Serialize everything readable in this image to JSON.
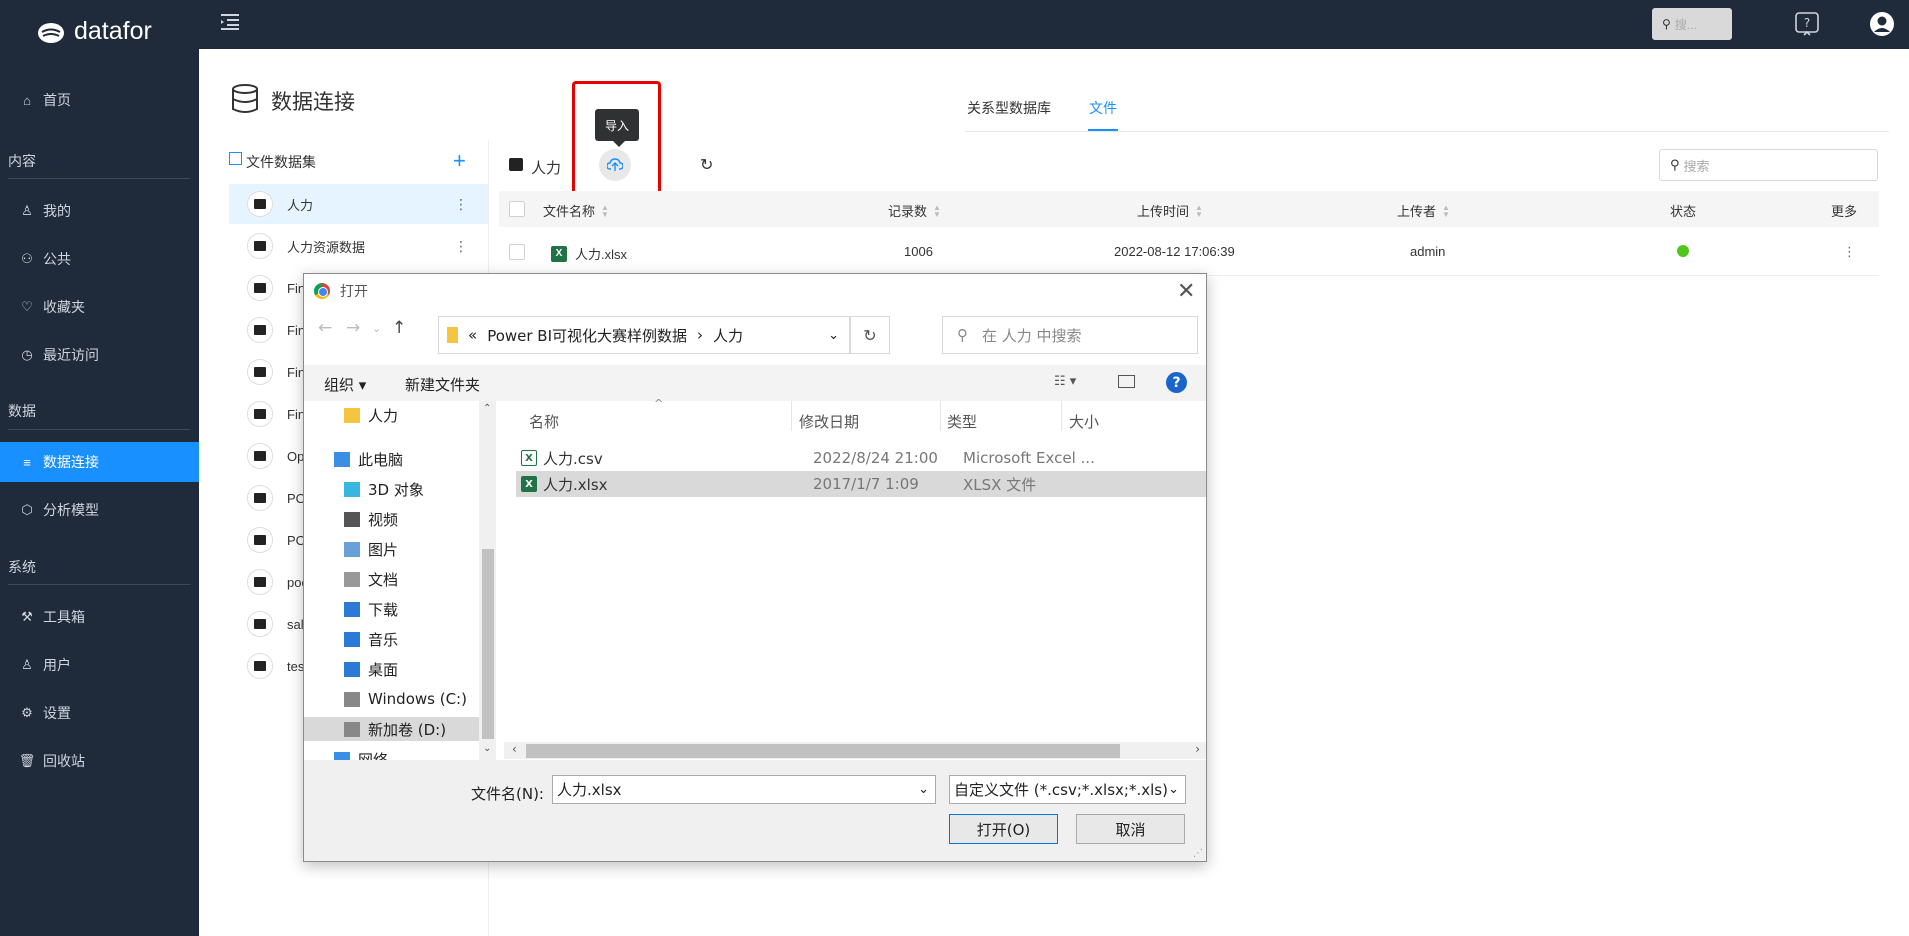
{
  "app": {
    "brand": "datafor"
  },
  "sidebar": {
    "home": "首页",
    "section_content": "内容",
    "mine": "我的",
    "public": "公共",
    "favorites": "收藏夹",
    "recent": "最近访问",
    "section_data": "数据",
    "data_connection": "数据连接",
    "analysis_model": "分析模型",
    "section_system": "系统",
    "toolbox": "工具箱",
    "users": "用户",
    "settings": "设置",
    "recycle": "回收站"
  },
  "topbar": {
    "search_placeholder": "搜..."
  },
  "main": {
    "title": "数据连接",
    "tabs": [
      "关系型数据库",
      "文件"
    ],
    "active_tab": "文件",
    "datasets_title": "文件数据集",
    "datasets": [
      "人力",
      "人力资源数据",
      "Fin",
      "Fin",
      "Fin",
      "Fin",
      "Ope",
      "PO",
      "PO",
      "poo",
      "sale",
      "tes"
    ],
    "folder_name": "人力",
    "upload_tooltip": "导入",
    "list_search_placeholder": "搜索",
    "table_headers": {
      "name": "文件名称",
      "records": "记录数",
      "upload_time": "上传时间",
      "uploader": "上传者",
      "status": "状态",
      "more": "更多"
    },
    "rows": [
      {
        "name": "人力.xlsx",
        "records": "1006",
        "upload_time": "2022-08-12 17:06:39",
        "uploader": "admin",
        "status": "ok"
      }
    ]
  },
  "dialog": {
    "title": "打开",
    "path": [
      "«",
      "Power BI可视化大赛样例数据",
      "›",
      "人力"
    ],
    "search_placeholder": "在 人力 中搜索",
    "organize": "组织 ▾",
    "new_folder": "新建文件夹",
    "tree": [
      "人力",
      "此电脑",
      "3D 对象",
      "视频",
      "图片",
      "文档",
      "下载",
      "音乐",
      "桌面",
      "Windows (C:)",
      "新加卷 (D:)",
      "网络"
    ],
    "columns": [
      "名称",
      "修改日期",
      "类型",
      "大小"
    ],
    "files": [
      {
        "name": "人力.csv",
        "date": "2022/8/24 21:00",
        "type": "Microsoft Excel ..."
      },
      {
        "name": "人力.xlsx",
        "date": "2017/1/7 1:09",
        "type": "XLSX 文件"
      }
    ],
    "filename_label": "文件名(N):",
    "filename_value": "人力.xlsx",
    "filetype_value": "自定义文件 (*.csv;*.xlsx;*.xls)",
    "open_button": "打开(O)",
    "cancel_button": "取消"
  }
}
